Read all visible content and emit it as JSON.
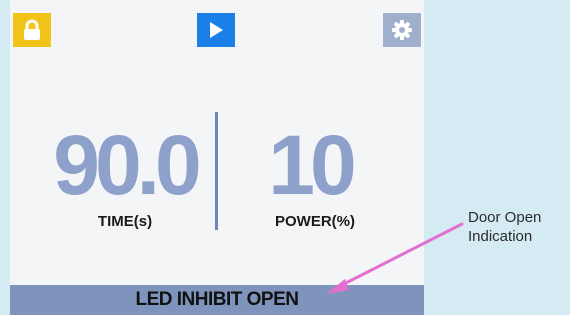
{
  "screen": {
    "top_bar": {
      "lock_button_icon": "lock-icon",
      "play_button_icon": "play-icon",
      "settings_button_icon": "gear-icon"
    },
    "time": {
      "value": "90.0",
      "label": "TIME(s)"
    },
    "power": {
      "value": "10",
      "label": "POWER(%)"
    },
    "status_bar": {
      "text": "LED INHIBIT OPEN"
    }
  },
  "annotation": {
    "line1": "Door Open",
    "line2": "Indication"
  },
  "colors": {
    "lock_button": "#f2c318",
    "play_button": "#1a7fe6",
    "settings_button": "#9fafcc",
    "value_text": "#8ea1cb",
    "status_bar": "#7f94bc",
    "arrow": "#e36fd0",
    "background": "#d5ebf4"
  }
}
